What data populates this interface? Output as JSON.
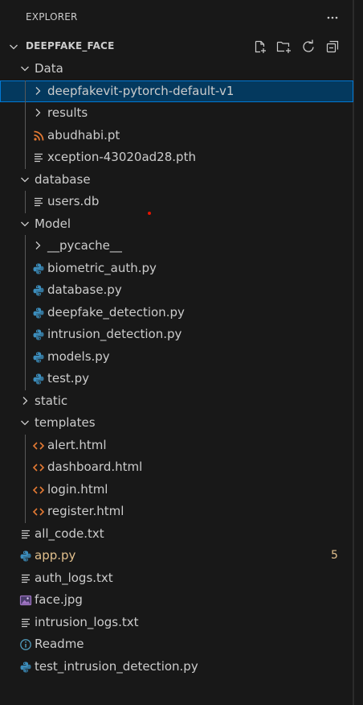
{
  "panel": {
    "title": "EXPLORER",
    "more_icon": "ellipsis-icon"
  },
  "workspace": {
    "name": "DEEPFAKE_FACE",
    "actions": [
      "new-file-icon",
      "new-folder-icon",
      "refresh-icon",
      "collapse-all-icon"
    ]
  },
  "tree": [
    {
      "label": "Data",
      "kind": "folder",
      "depth": 1,
      "expanded": true
    },
    {
      "label": "deepfakevit-pytorch-default-v1",
      "kind": "folder",
      "depth": 2,
      "expanded": false,
      "selected": true
    },
    {
      "label": "results",
      "kind": "folder",
      "depth": 2,
      "expanded": false
    },
    {
      "label": "abudhabi.pt",
      "kind": "file",
      "icon": "rss-icon",
      "depth": 2
    },
    {
      "label": "xception-43020ad28.pth",
      "kind": "file",
      "icon": "text-file-icon",
      "depth": 2
    },
    {
      "label": "database",
      "kind": "folder",
      "depth": 1,
      "expanded": true
    },
    {
      "label": "users.db",
      "kind": "file",
      "icon": "text-file-icon",
      "depth": 2
    },
    {
      "label": "Model",
      "kind": "folder",
      "depth": 1,
      "expanded": true
    },
    {
      "label": "__pycache__",
      "kind": "folder",
      "depth": 2,
      "expanded": false
    },
    {
      "label": "biometric_auth.py",
      "kind": "file",
      "icon": "python-icon",
      "depth": 2
    },
    {
      "label": "database.py",
      "kind": "file",
      "icon": "python-icon",
      "depth": 2
    },
    {
      "label": "deepfake_detection.py",
      "kind": "file",
      "icon": "python-icon",
      "depth": 2
    },
    {
      "label": "intrusion_detection.py",
      "kind": "file",
      "icon": "python-icon",
      "depth": 2
    },
    {
      "label": "models.py",
      "kind": "file",
      "icon": "python-icon",
      "depth": 2
    },
    {
      "label": "test.py",
      "kind": "file",
      "icon": "python-icon",
      "depth": 2
    },
    {
      "label": "static",
      "kind": "folder",
      "depth": 1,
      "expanded": false
    },
    {
      "label": "templates",
      "kind": "folder",
      "depth": 1,
      "expanded": true
    },
    {
      "label": "alert.html",
      "kind": "file",
      "icon": "html-icon",
      "depth": 2
    },
    {
      "label": "dashboard.html",
      "kind": "file",
      "icon": "html-icon",
      "depth": 2
    },
    {
      "label": "login.html",
      "kind": "file",
      "icon": "html-icon",
      "depth": 2
    },
    {
      "label": "register.html",
      "kind": "file",
      "icon": "html-icon",
      "depth": 2
    },
    {
      "label": "all_code.txt",
      "kind": "file",
      "icon": "text-file-icon",
      "depth": 1
    },
    {
      "label": "app.py",
      "kind": "file",
      "icon": "python-icon",
      "depth": 1,
      "modified": true,
      "badge": "5"
    },
    {
      "label": "auth_logs.txt",
      "kind": "file",
      "icon": "text-file-icon",
      "depth": 1
    },
    {
      "label": "face.jpg",
      "kind": "file",
      "icon": "image-icon",
      "depth": 1
    },
    {
      "label": "intrusion_logs.txt",
      "kind": "file",
      "icon": "text-file-icon",
      "depth": 1
    },
    {
      "label": "Readme",
      "kind": "file",
      "icon": "info-icon",
      "depth": 1
    },
    {
      "label": "test_intrusion_detection.py",
      "kind": "file",
      "icon": "python-icon",
      "depth": 1
    }
  ],
  "colors": {
    "background": "#181818",
    "text": "#cccccc",
    "selection": "#04395e",
    "focus_border": "#0078d4",
    "modified": "#e2c08d",
    "python": "#3c8dbc",
    "html": "#e37933",
    "rss": "#e37933",
    "image": "#a074c4",
    "info": "#519aba"
  }
}
